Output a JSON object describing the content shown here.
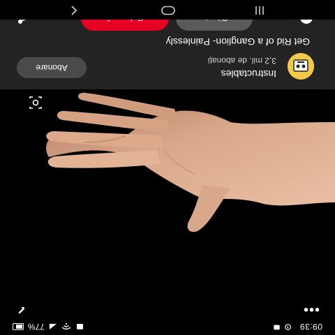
{
  "status_bar": {
    "time": "09:39",
    "battery": "77%"
  },
  "pin": {
    "channel_name": "Instructables",
    "subscribers": "3,2 mil. de abonați",
    "title": "Get Rid of a Ganglion- Painlessly",
    "subscribe_label": "Abonare",
    "read_label": "Citește",
    "save_label": "Salvează"
  },
  "colors": {
    "save_red": "#e60023",
    "card": "#232323"
  }
}
